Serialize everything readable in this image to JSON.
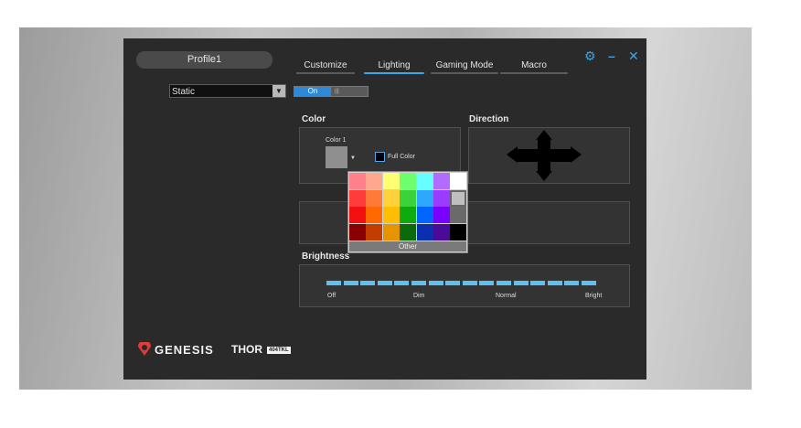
{
  "profile": {
    "name": "Profile1"
  },
  "tabs": [
    {
      "label": "Customize",
      "active": false
    },
    {
      "label": "Lighting",
      "active": true
    },
    {
      "label": "Gaming Mode",
      "active": false
    },
    {
      "label": "Macro",
      "active": false
    }
  ],
  "window_controls": {
    "settings_icon": "gear-icon",
    "minimize_icon": "minimize-icon",
    "close_icon": "close-icon"
  },
  "effect_select": {
    "value": "Static"
  },
  "toggle": {
    "on_label": "On",
    "state": "on"
  },
  "color_section": {
    "title": "Color",
    "color1_label": "Color 1",
    "full_color_label": "Full Color",
    "swatch_color": "#8f8f8f"
  },
  "direction_section": {
    "title": "Direction"
  },
  "palette": {
    "rows": [
      [
        "#ff7f8a",
        "#ffa78f",
        "#ffff73",
        "#6eff6e",
        "#66ffff",
        "#b26bff",
        "#ffffff"
      ],
      [
        "#ff3b3b",
        "#ff7a38",
        "#ffd23c",
        "#3ad43a",
        "#2ea8ff",
        "#9a3cff",
        "#bfbfbf"
      ],
      [
        "#f21010",
        "#ff6a00",
        "#ffbf00",
        "#0eaa0e",
        "#0066ff",
        "#7a00ff",
        "#6a6a6a"
      ],
      [
        "#8a0000",
        "#c43d00",
        "#e69500",
        "#0b6b0b",
        "#0a2fb0",
        "#4a0a9a",
        "#000000"
      ]
    ],
    "selected": [
      1,
      6
    ],
    "other_label": "Other"
  },
  "brightness": {
    "title": "Brightness",
    "segments": 16,
    "level": 1.0,
    "labels": [
      "Off",
      "Dim",
      "Normal",
      "Bright"
    ]
  },
  "branding": {
    "logo_text": "GENESIS",
    "model": "THOR",
    "model_badge": "404TKL"
  }
}
